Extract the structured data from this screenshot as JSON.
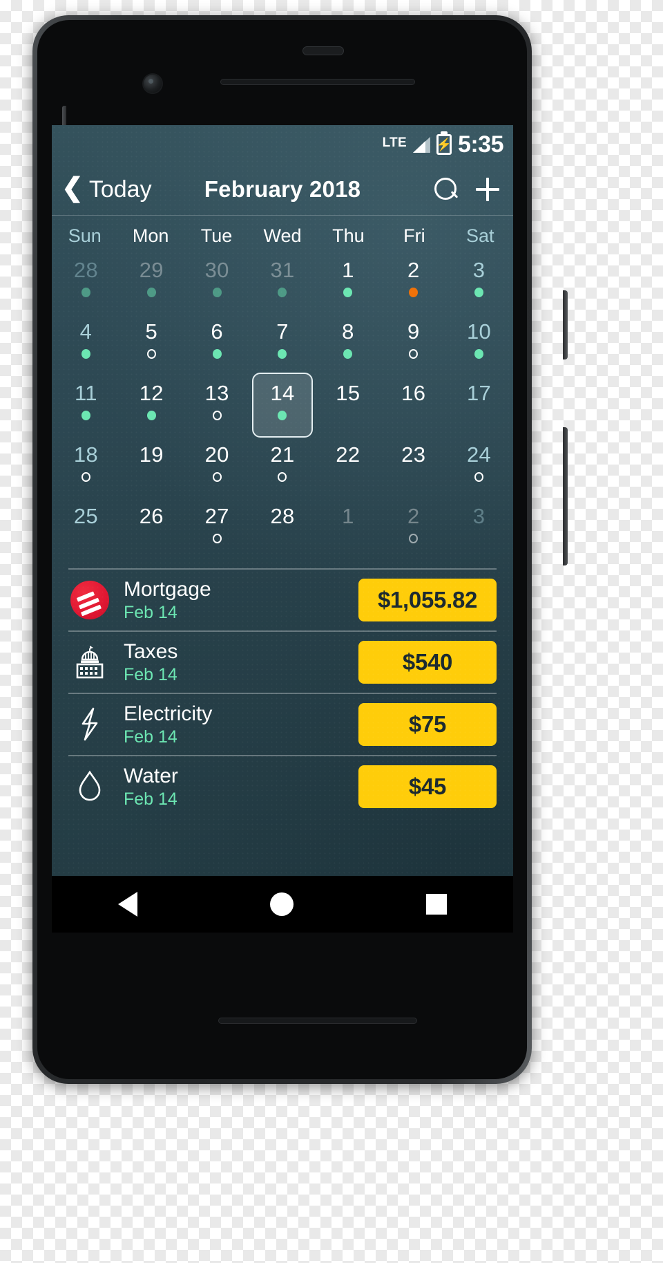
{
  "statusbar": {
    "network": "LTE",
    "signal_icon": "signal-bars-icon",
    "battery_icon": "battery-charging-icon",
    "battery_bolt": "⚡",
    "time": "5:35"
  },
  "navbar": {
    "back_icon": "chevron-left-icon",
    "back_label": "Today",
    "title": "February 2018",
    "search_icon": "search-icon",
    "add_icon": "plus-icon"
  },
  "calendar": {
    "weekdays": [
      {
        "label": "Sun",
        "weekend": true
      },
      {
        "label": "Mon",
        "weekend": false
      },
      {
        "label": "Tue",
        "weekend": false
      },
      {
        "label": "Wed",
        "weekend": false
      },
      {
        "label": "Thu",
        "weekend": false
      },
      {
        "label": "Fri",
        "weekend": false
      },
      {
        "label": "Sat",
        "weekend": true
      }
    ],
    "selected_day": 14,
    "weeks": [
      [
        {
          "num": "28",
          "marker": "filled-dim",
          "out": true,
          "weekend": true
        },
        {
          "num": "29",
          "marker": "filled-dim",
          "out": true,
          "weekend": false
        },
        {
          "num": "30",
          "marker": "filled-dim",
          "out": true,
          "weekend": false
        },
        {
          "num": "31",
          "marker": "filled-dim",
          "out": true,
          "weekend": false
        },
        {
          "num": "1",
          "marker": "filled",
          "out": false,
          "weekend": false
        },
        {
          "num": "2",
          "marker": "orange",
          "out": false,
          "weekend": false
        },
        {
          "num": "3",
          "marker": "filled",
          "out": false,
          "weekend": true
        }
      ],
      [
        {
          "num": "4",
          "marker": "filled",
          "out": false,
          "weekend": true
        },
        {
          "num": "5",
          "marker": "hollow",
          "out": false,
          "weekend": false
        },
        {
          "num": "6",
          "marker": "filled",
          "out": false,
          "weekend": false
        },
        {
          "num": "7",
          "marker": "filled",
          "out": false,
          "weekend": false
        },
        {
          "num": "8",
          "marker": "filled",
          "out": false,
          "weekend": false
        },
        {
          "num": "9",
          "marker": "hollow",
          "out": false,
          "weekend": false
        },
        {
          "num": "10",
          "marker": "filled",
          "out": false,
          "weekend": true
        }
      ],
      [
        {
          "num": "11",
          "marker": "filled",
          "out": false,
          "weekend": true
        },
        {
          "num": "12",
          "marker": "filled",
          "out": false,
          "weekend": false
        },
        {
          "num": "13",
          "marker": "hollow",
          "out": false,
          "weekend": false
        },
        {
          "num": "14",
          "marker": "filled",
          "out": false,
          "weekend": false,
          "selected": true
        },
        {
          "num": "15",
          "marker": "none",
          "out": false,
          "weekend": false
        },
        {
          "num": "16",
          "marker": "none",
          "out": false,
          "weekend": false
        },
        {
          "num": "17",
          "marker": "none",
          "out": false,
          "weekend": true
        }
      ],
      [
        {
          "num": "18",
          "marker": "hollow",
          "out": false,
          "weekend": true
        },
        {
          "num": "19",
          "marker": "none",
          "out": false,
          "weekend": false
        },
        {
          "num": "20",
          "marker": "hollow",
          "out": false,
          "weekend": false
        },
        {
          "num": "21",
          "marker": "hollow",
          "out": false,
          "weekend": false
        },
        {
          "num": "22",
          "marker": "none",
          "out": false,
          "weekend": false
        },
        {
          "num": "23",
          "marker": "none",
          "out": false,
          "weekend": false
        },
        {
          "num": "24",
          "marker": "hollow",
          "out": false,
          "weekend": true
        }
      ],
      [
        {
          "num": "25",
          "marker": "none",
          "out": false,
          "weekend": true
        },
        {
          "num": "26",
          "marker": "none",
          "out": false,
          "weekend": false
        },
        {
          "num": "27",
          "marker": "hollow",
          "out": false,
          "weekend": false
        },
        {
          "num": "28",
          "marker": "none",
          "out": false,
          "weekend": false
        },
        {
          "num": "1",
          "marker": "none",
          "out": true,
          "weekend": false
        },
        {
          "num": "2",
          "marker": "hollow-dim",
          "out": true,
          "weekend": false
        },
        {
          "num": "3",
          "marker": "none",
          "out": true,
          "weekend": true
        }
      ]
    ]
  },
  "bills": [
    {
      "icon": "bank-of-america-logo",
      "name": "Mortgage",
      "date": "Feb 14",
      "amount": "$1,055.82"
    },
    {
      "icon": "capitol-building-icon",
      "name": "Taxes",
      "date": "Feb 14",
      "amount": "$540"
    },
    {
      "icon": "lightning-bolt-icon",
      "name": "Electricity",
      "date": "Feb 14",
      "amount": "$75"
    },
    {
      "icon": "water-drop-icon",
      "name": "Water",
      "date": "Feb 14",
      "amount": "$45"
    }
  ],
  "os_nav": {
    "back": "back-triangle-icon",
    "home": "home-circle-icon",
    "recents": "recents-square-icon"
  },
  "colors": {
    "accent_amount": "#ffcd0a",
    "accent_date": "#6ce6b2",
    "marker_due": "#f07209",
    "screen_bg": "#2a444e"
  }
}
